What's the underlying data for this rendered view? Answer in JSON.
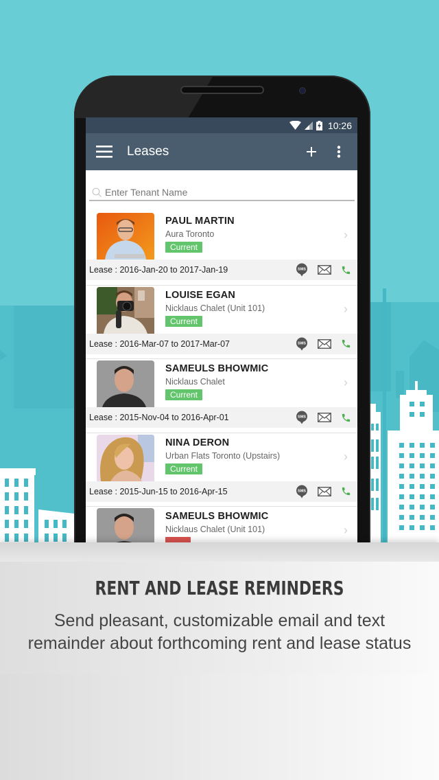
{
  "status_bar": {
    "time": "10:26"
  },
  "app_bar": {
    "title": "Leases",
    "menu_icon": "hamburger-menu-icon",
    "add_icon": "plus-icon",
    "overflow_icon": "more-vert-icon"
  },
  "search": {
    "placeholder": "Enter Tenant Name",
    "value": ""
  },
  "leases": [
    {
      "name": "PAUL MARTIN",
      "property": "Aura Toronto",
      "status": "Current",
      "lease": "Lease : 2016-Jan-20 to 2017-Jan-19"
    },
    {
      "name": "LOUISE EGAN",
      "property": "Nicklaus Chalet (Unit 101)",
      "status": "Current",
      "lease": "Lease : 2016-Mar-07 to 2017-Mar-07"
    },
    {
      "name": "SAMEULS BHOWMIC",
      "property": "Nicklaus Chalet",
      "status": "Current",
      "lease": "Lease : 2015-Nov-04 to 2016-Apr-01"
    },
    {
      "name": "NINA DERON",
      "property": "Urban Flats Toronto (Upstairs)",
      "status": "Current",
      "lease": "Lease : 2015-Jun-15 to 2016-Apr-15"
    },
    {
      "name": "SAMEULS BHOWMIC",
      "property": "Nicklaus Chalet (Unit 101)",
      "status": "",
      "lease": ""
    }
  ],
  "action_labels": {
    "sms": "SMS"
  },
  "caption": {
    "title": "RENT AND LEASE REMINDERS",
    "line1": "Send pleasant, customizable email and text",
    "line2": "remainder about forthcoming rent and lease status"
  },
  "colors": {
    "background": "#68cdd5",
    "app_bar": "#4a5d6e",
    "status_bar": "#37495a",
    "badge_current": "#62c56b",
    "badge_overdue": "#d9534f",
    "phone_icon": "#4cae4f"
  }
}
